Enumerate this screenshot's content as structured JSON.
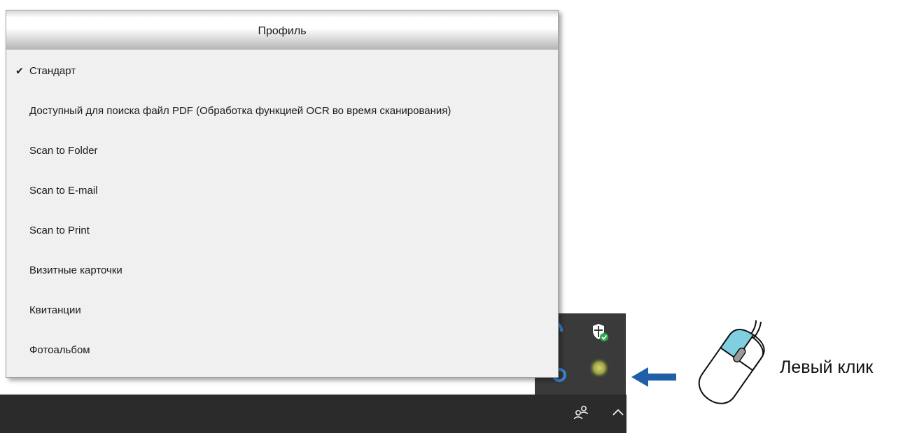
{
  "menu": {
    "title": "Профиль",
    "items": [
      {
        "label": "Стандарт",
        "checked": true
      },
      {
        "label": "Доступный для поиска файл PDF (Обработка функцией OCR во время сканирования)",
        "checked": false
      },
      {
        "label": "Scan to Folder",
        "checked": false
      },
      {
        "label": "Scan to E-mail",
        "checked": false
      },
      {
        "label": "Scan to Print",
        "checked": false
      },
      {
        "label": "Визитные карточки",
        "checked": false
      },
      {
        "label": "Квитанции",
        "checked": false
      },
      {
        "label": "Фотоальбом",
        "checked": false
      }
    ],
    "check_glyph": "✔"
  },
  "annotation": {
    "caption": "Левый клик",
    "arrow_color": "#1f5fa8",
    "mouse_button_color": "#7fcfe0"
  },
  "taskbar": {
    "icons": [
      "people-icon",
      "chevron-up-icon"
    ]
  },
  "tray": {
    "icons": [
      "app-icon-blue",
      "windows-security-shield-icon",
      "app-icon-blue",
      "scanner-status-icon"
    ]
  }
}
